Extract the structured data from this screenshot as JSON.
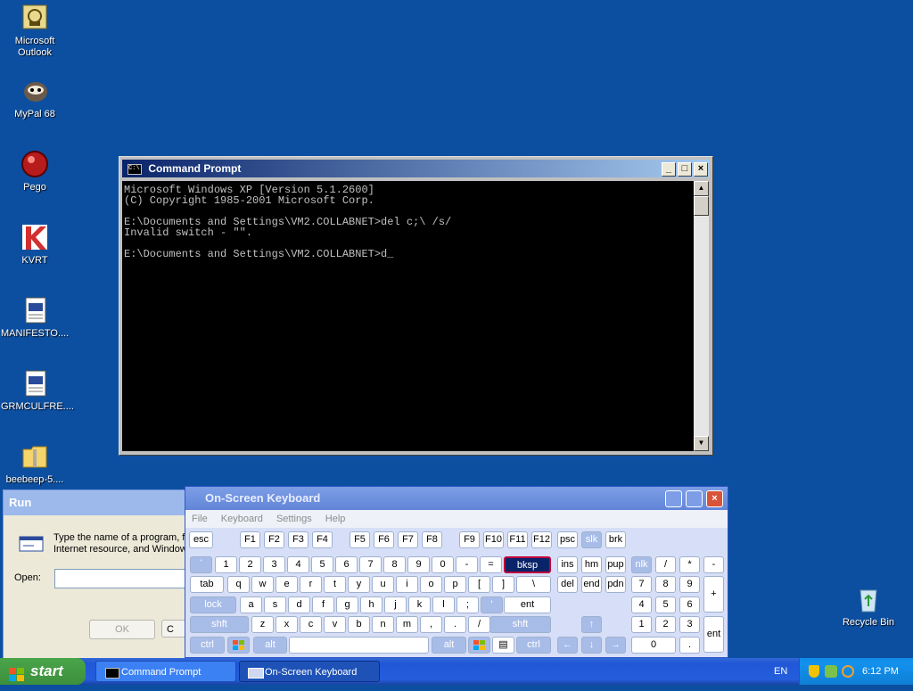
{
  "desktop": {
    "icons": [
      {
        "label": "Microsoft Outlook"
      },
      {
        "label": "MyPal 68"
      },
      {
        "label": "Pego"
      },
      {
        "label": "KVRT"
      },
      {
        "label": "MANIFESTO...."
      },
      {
        "label": "GRMCULFRE...."
      },
      {
        "label": "beebeep-5...."
      },
      {
        "label": "Recycle Bin"
      }
    ]
  },
  "cmd": {
    "title": "Command Prompt",
    "lines": [
      "Microsoft Windows XP [Version 5.1.2600]",
      "(C) Copyright 1985-2001 Microsoft Corp.",
      "",
      "E:\\Documents and Settings\\VM2.COLLABNET>del c;\\ /s/",
      "Invalid switch - \"\".",
      "",
      "E:\\Documents and Settings\\VM2.COLLABNET>d_"
    ]
  },
  "run": {
    "title": "Run",
    "description": "Type the name of a program, f\nInternet resource, and Window",
    "open_label": "Open:",
    "ok_label": "OK",
    "cancel_label": "C"
  },
  "osk": {
    "title": "On-Screen Keyboard",
    "menu": [
      "File",
      "Keyboard",
      "Settings",
      "Help"
    ]
  },
  "taskbar": {
    "start_label": "start",
    "tasks": [
      "Command Prompt",
      "On-Screen Keyboard"
    ],
    "lang": "EN",
    "clock": "6:12 PM"
  },
  "colors": {
    "desktop": "#0c4fa0",
    "highlight_key": "#0a246a"
  }
}
